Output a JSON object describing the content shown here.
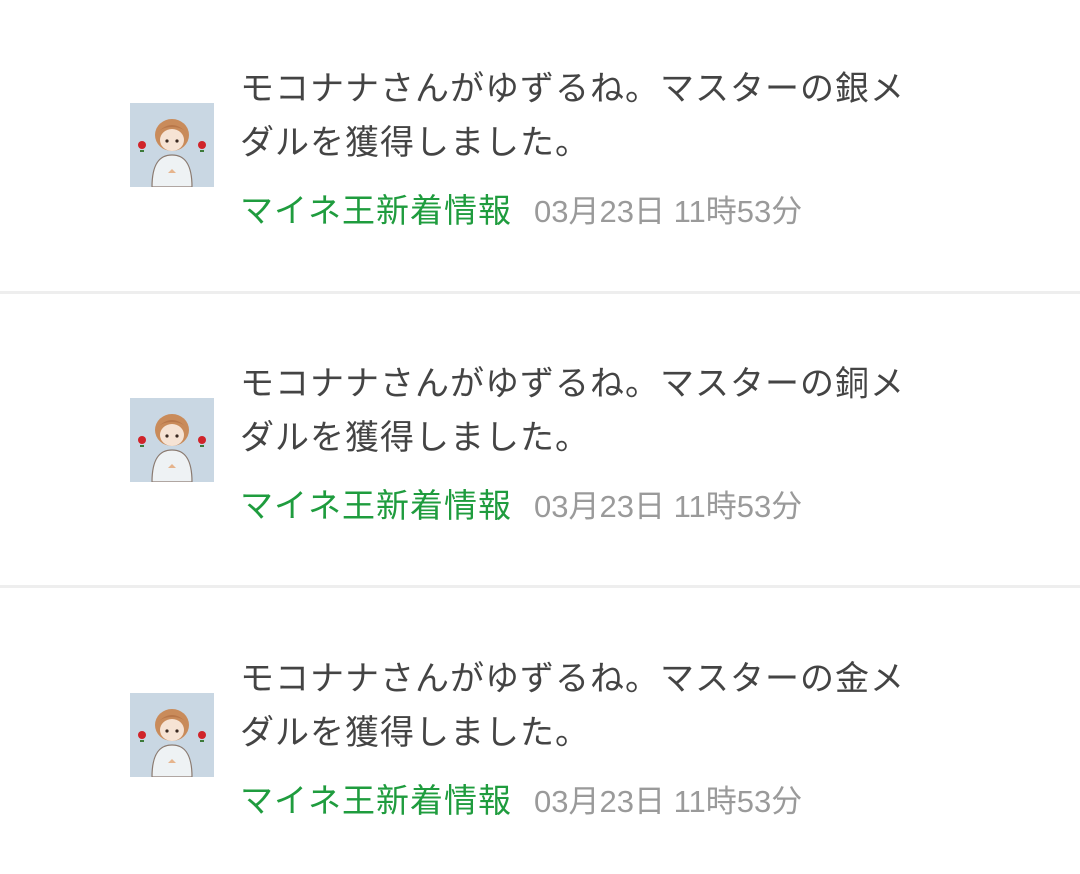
{
  "feed": {
    "items": [
      {
        "message": "モコナナさんがゆずるね。マスターの銀メ\nダルを獲得しました。",
        "source": "マイネ王新着情報",
        "timestamp": "03月23日 11時53分",
        "avatar_icon": "user-avatar-icon"
      },
      {
        "message": "モコナナさんがゆずるね。マスターの銅メ\nダルを獲得しました。",
        "source": "マイネ王新着情報",
        "timestamp": "03月23日 11時53分",
        "avatar_icon": "user-avatar-icon"
      },
      {
        "message": "モコナナさんがゆずるね。マスターの金メ\nダルを獲得しました。",
        "source": "マイネ王新着情報",
        "timestamp": "03月23日 11時53分",
        "avatar_icon": "user-avatar-icon"
      }
    ],
    "colors": {
      "source_link": "#1f9c3e",
      "timestamp": "#9a9a9a",
      "message_text": "#444444",
      "divider": "#eeeeee",
      "avatar_bg": "#c9d7e3"
    }
  }
}
